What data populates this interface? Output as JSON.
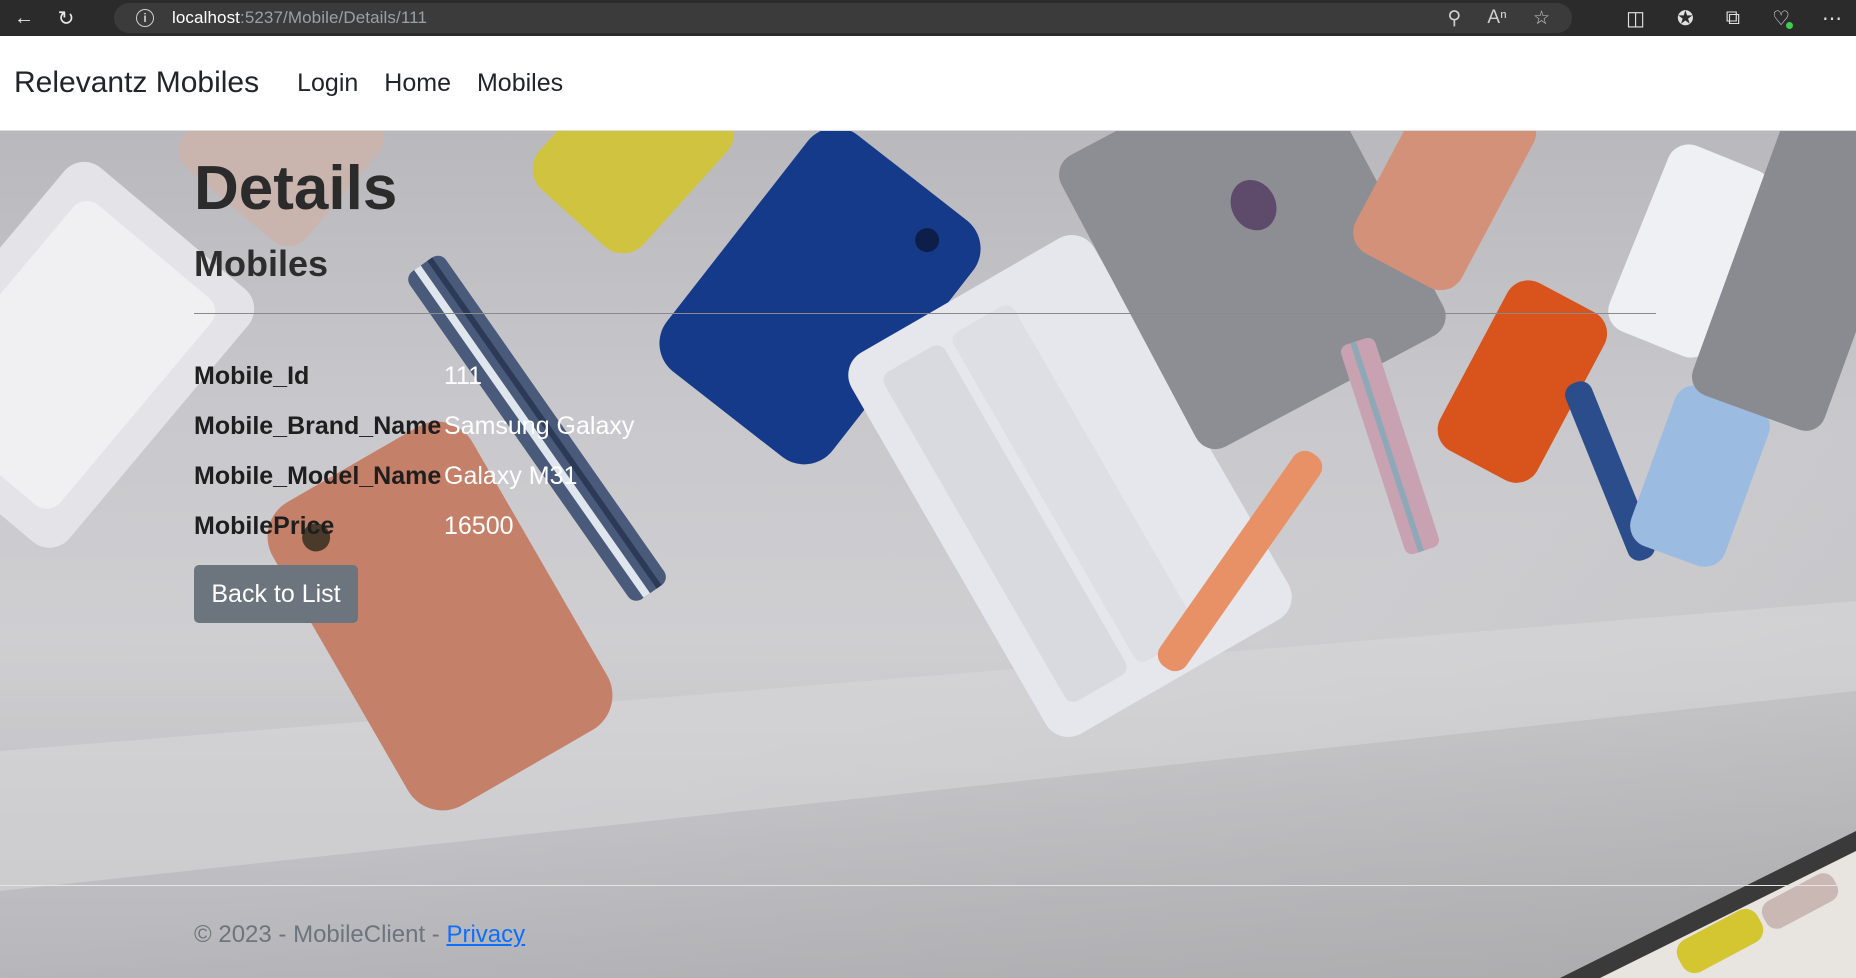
{
  "browser": {
    "url_host": "localhost",
    "url_rest": ":5237/Mobile/Details/111"
  },
  "navbar": {
    "brand": "Relevantz Mobiles",
    "links": [
      "Login",
      "Home",
      "Mobiles"
    ]
  },
  "main": {
    "title": "Details",
    "subtitle": "Mobiles",
    "details": [
      {
        "label": "Mobile_Id",
        "value": "111"
      },
      {
        "label": "Mobile_Brand_Name",
        "value": "Samsung Galaxy"
      },
      {
        "label": "Mobile_Model_Name",
        "value": "Galaxy M31"
      },
      {
        "label": "MobilePrice",
        "value": "16500"
      }
    ],
    "back_label": "Back to List"
  },
  "footer": {
    "text": "© 2023 - MobileClient - ",
    "privacy": "Privacy"
  },
  "colors": {
    "button": "#6c757d",
    "link": "#0d6efd"
  }
}
